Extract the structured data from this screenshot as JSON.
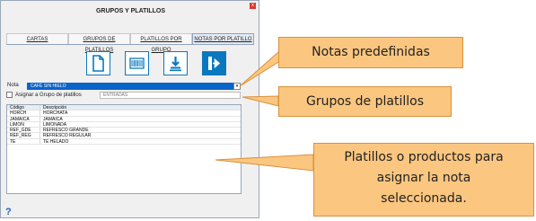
{
  "window": {
    "title": "GRUPOS Y PLATILLOS",
    "close_label": "x"
  },
  "tabs": [
    {
      "label": "CARTAS"
    },
    {
      "label": "GRUPOS DE PLATILLOS"
    },
    {
      "label": "PLATILLOS POR GRUPO"
    },
    {
      "label": "NOTAS POR PLATILLO"
    }
  ],
  "toolbar_icons": [
    "new-document-icon",
    "barcode-icon",
    "download-icon",
    "exit-icon"
  ],
  "form": {
    "nota_label": "Nota",
    "nota_value": "CAFÉ SIN HIELO",
    "assign_label": "Asignar a Grupo de platillos",
    "group_value": "ENTRADAS"
  },
  "grid": {
    "headers": [
      "Código",
      "Descripción"
    ],
    "rows": [
      [
        "HORCH",
        "HORCHATA"
      ],
      [
        "JAMAICA",
        "JAMAICA"
      ],
      [
        "LIMON",
        "LIMONADA"
      ],
      [
        "REF_GDE",
        "REFRESCO GRANDE"
      ],
      [
        "REF_REG",
        "REFRESCO REGULAR"
      ],
      [
        "TE",
        "TE HELADO"
      ]
    ]
  },
  "help_label": "?",
  "callouts": {
    "notas": "Notas predefinidas",
    "grupos": "Grupos de platillos",
    "platillos_line1": "Platillos o productos para",
    "platillos_line2": "asignar la nota",
    "platillos_line3": "seleccionada."
  },
  "colors": {
    "accent": "#0a78bf",
    "selection": "#0a63c8",
    "callout": "#fbc67f"
  }
}
